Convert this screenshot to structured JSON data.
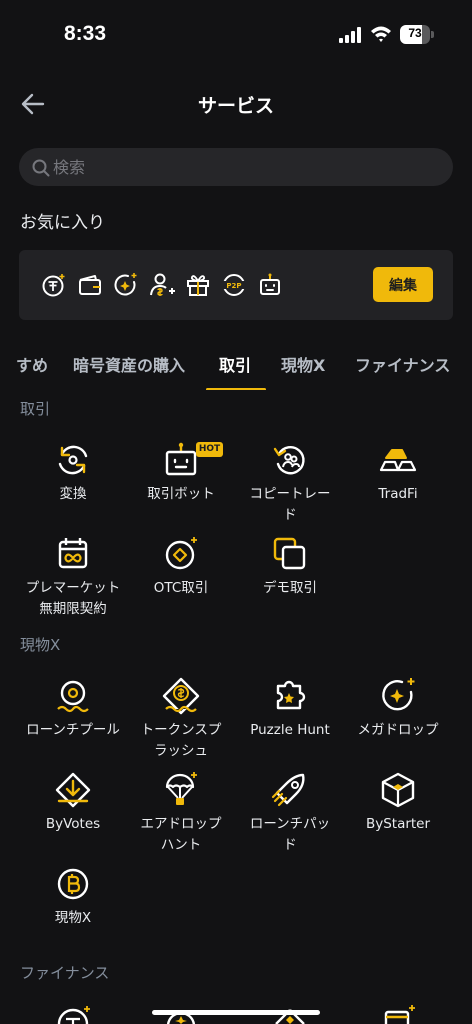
{
  "status_bar": {
    "time": "8:33",
    "battery_level": 73,
    "battery_text": "73"
  },
  "header": {
    "title": "サービス"
  },
  "search": {
    "placeholder": "検索"
  },
  "favorites": {
    "label": "お気に入り",
    "icons": [
      "token-icon",
      "wallet-icon",
      "megadrop-icon",
      "user-add-icon",
      "gift-icon",
      "p2p-icon",
      "robot-icon"
    ],
    "edit_label": "編集"
  },
  "tabs": [
    {
      "label": "すめ"
    },
    {
      "label": "暗号資産の購入"
    },
    {
      "label": "取引",
      "active": true
    },
    {
      "label": "現物X"
    },
    {
      "label": "ファイナンス"
    }
  ],
  "sections": {
    "trade": {
      "title": "取引",
      "items": [
        {
          "label": "変換",
          "icon": "convert-icon"
        },
        {
          "label": "取引ボット",
          "icon": "robot-icon",
          "badge": "HOT"
        },
        {
          "label": "コピートレード",
          "label_line1": "コピートレー",
          "label_line2": "ド",
          "icon": "copy-trade-icon"
        },
        {
          "label": "TradFi",
          "icon": "gold-bars-icon"
        },
        {
          "label": "プレマーケット無期限契約",
          "label_line1": "プレマーケット",
          "label_line2": "無期限契約",
          "icon": "calendar-infinity-icon"
        },
        {
          "label": "OTC取引",
          "icon": "otc-diamond-icon"
        },
        {
          "label": "デモ取引",
          "icon": "demo-squares-icon"
        }
      ]
    },
    "spot_x": {
      "title": "現物X",
      "items": [
        {
          "label": "ローンチプール",
          "icon": "launchpool-icon"
        },
        {
          "label": "トークンスプラッシュ",
          "label_line1": "トークンスプ",
          "label_line2": "ラッシュ",
          "icon": "token-splash-icon"
        },
        {
          "label": "Puzzle Hunt",
          "icon": "puzzle-icon"
        },
        {
          "label": "メガドロップ",
          "icon": "megadrop-icon"
        },
        {
          "label": "ByVotes",
          "icon": "vote-icon"
        },
        {
          "label": "エアドロップハント",
          "label_line1": "エアドロップ",
          "label_line2": "ハント",
          "icon": "parachute-icon"
        },
        {
          "label": "ローンチパッド",
          "label_line1": "ローンチパッ",
          "label_line2": "ド",
          "icon": "rocket-icon"
        },
        {
          "label": "ByStarter",
          "icon": "cube-icon"
        },
        {
          "label": "現物X",
          "icon": "bitcoin-icon"
        }
      ]
    },
    "finance": {
      "title": "ファイナンス"
    }
  },
  "colors": {
    "accent": "#f0b90b",
    "background": "#121214",
    "surface": "#222225",
    "text": "#eaecef",
    "muted": "#848e9c"
  }
}
